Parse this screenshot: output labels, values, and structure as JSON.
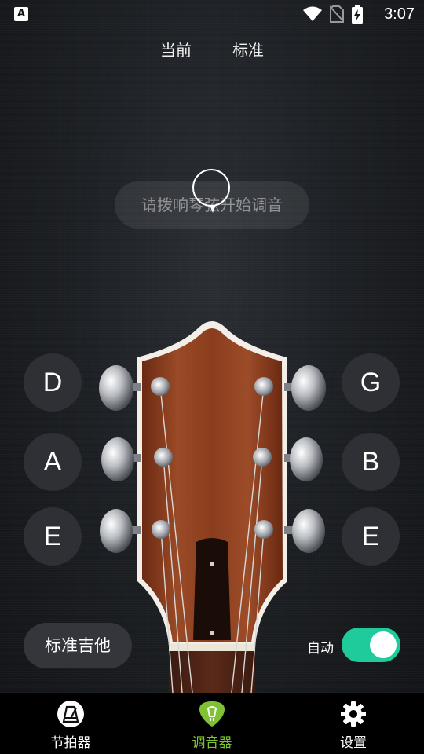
{
  "status_bar": {
    "time": "3:07",
    "app_icon_letter": "A"
  },
  "top_tabs": {
    "current": "当前",
    "standard": "标准"
  },
  "prompt": "请拨响琴弦开始调音",
  "strings": {
    "left": [
      "D",
      "A",
      "E"
    ],
    "right": [
      "G",
      "B",
      "E"
    ]
  },
  "preset_button": "标准吉他",
  "auto": {
    "label": "自动",
    "enabled": true
  },
  "nav": {
    "metronome": "节拍器",
    "tuner": "调音器",
    "settings": "设置",
    "active": "tuner"
  },
  "colors": {
    "accent_green": "#7fc233",
    "toggle_on": "#1fcb9a"
  }
}
